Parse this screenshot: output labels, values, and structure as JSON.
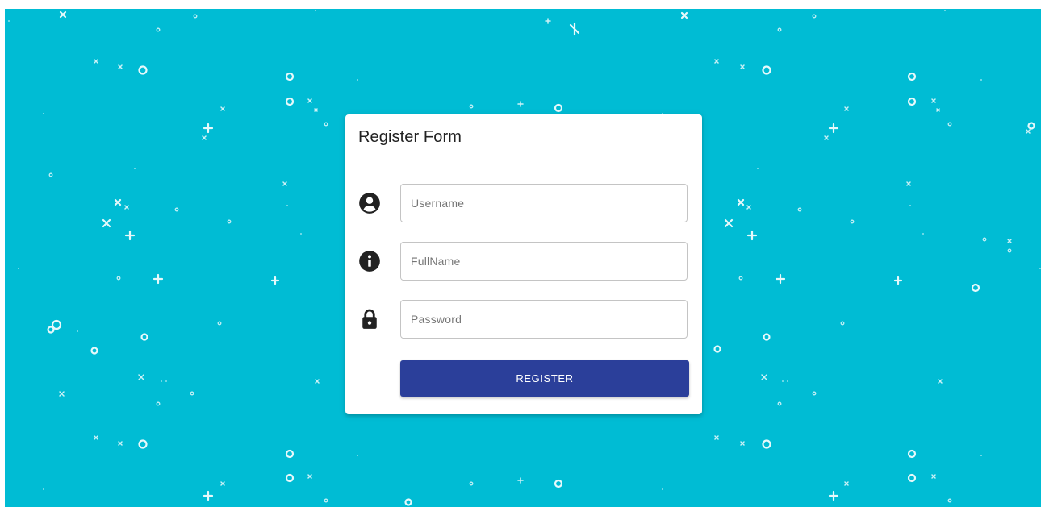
{
  "colors": {
    "background": "#00bcd4",
    "card": "#ffffff",
    "button": "#2b3f9a",
    "button_text": "#ffffff",
    "icon": "#222222",
    "field_border": "#c4c4c4"
  },
  "background": {
    "pattern_icon": "doodle-pattern"
  },
  "form": {
    "title": "Register Form",
    "fields": [
      {
        "name": "username",
        "icon": "account-circle-icon",
        "placeholder": "Username",
        "value": ""
      },
      {
        "name": "fullname",
        "icon": "info-icon",
        "placeholder": "FullName",
        "value": ""
      },
      {
        "name": "password",
        "icon": "lock-icon",
        "placeholder": "Password",
        "value": ""
      }
    ],
    "submit_label": "REGISTER"
  }
}
